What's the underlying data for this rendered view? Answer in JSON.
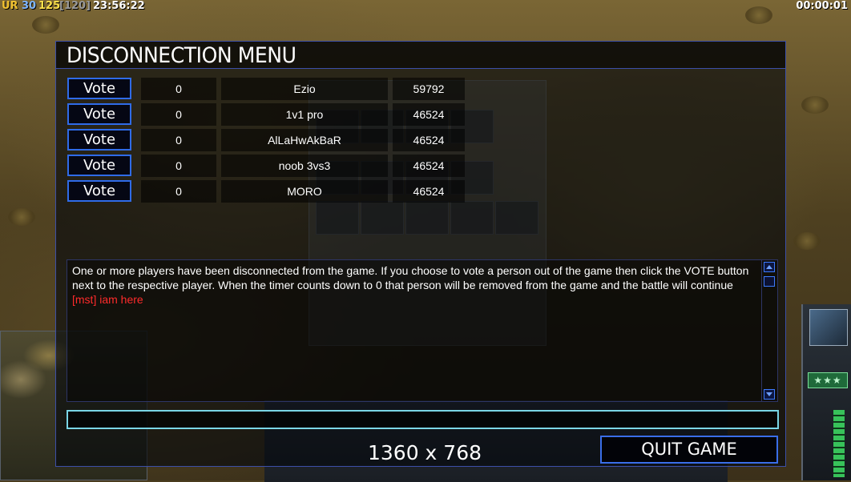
{
  "hud": {
    "faction": "UR",
    "stat_a": "30",
    "stat_b": "125",
    "stat_c": "[120]",
    "clock": "23:56:22",
    "timer": "00:00:01"
  },
  "dialog": {
    "title": "DISCONNECTION MENU",
    "players": [
      {
        "vote_label": "Vote",
        "votes": "0",
        "name": "Ezio",
        "ping": "59792"
      },
      {
        "vote_label": "Vote",
        "votes": "0",
        "name": "1v1 pro",
        "ping": "46524"
      },
      {
        "vote_label": "Vote",
        "votes": "0",
        "name": "AlLaHwAkBaR",
        "ping": "46524"
      },
      {
        "vote_label": "Vote",
        "votes": "0",
        "name": "noob 3vs3",
        "ping": "46524"
      },
      {
        "vote_label": "Vote",
        "votes": "0",
        "name": "MORO",
        "ping": "46524"
      }
    ],
    "chat": {
      "system_message": "One or more players have been disconnected from the game. If you choose to vote a person out of the game then click the VOTE button next to the respective player. When the timer counts down to 0 that person will be removed from the game and the battle will continue",
      "player_message": "[mst] iam here"
    },
    "chat_input": {
      "value": ""
    },
    "resolution": "1360 x 768",
    "quit_label": "QUIT GAME"
  },
  "colors": {
    "dialog_border": "#3c4fa8",
    "vote_border": "#2f6be8",
    "chat_input_border": "#7ad6e6",
    "player_message": "#ff2b2b",
    "hud_faction": "#f2c230",
    "hud_stat_a": "#7fb6ff",
    "hud_stat_b": "#ffe14a"
  }
}
